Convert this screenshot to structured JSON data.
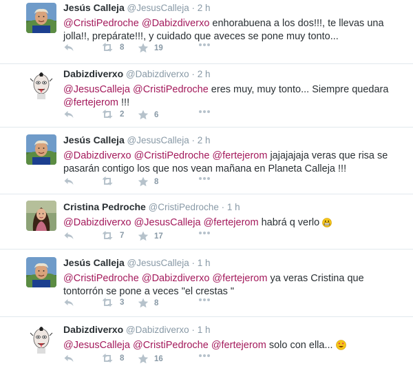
{
  "tweets": [
    {
      "name": "Jesús Calleja",
      "handle": "@JesusCalleja",
      "sep": "·",
      "time": "2 h",
      "segments": [
        {
          "t": "@CristiPedroche",
          "m": true
        },
        {
          "t": " ",
          "m": false
        },
        {
          "t": "@Dabizdiverxo",
          "m": true
        },
        {
          "t": " enhorabuena a los dos!!!, te llevas una jolla!!, prepárate!!!, y cuidado que aveces se pone muy tonto...",
          "m": false
        }
      ],
      "retweets": "8",
      "favorites": "19",
      "avatar": "calleja"
    },
    {
      "name": "Dabizdiverxo",
      "handle": "@Dabizdiverxo",
      "sep": "·",
      "time": "2 h",
      "segments": [
        {
          "t": "@JesusCalleja",
          "m": true
        },
        {
          "t": " ",
          "m": false
        },
        {
          "t": "@CristiPedroche",
          "m": true
        },
        {
          "t": " eres muy, muy tonto... Siempre quedara ",
          "m": false
        },
        {
          "t": "@fertejerom",
          "m": true
        },
        {
          "t": " !!!",
          "m": false
        }
      ],
      "retweets": "2",
      "favorites": "6",
      "avatar": "dabiz"
    },
    {
      "name": "Jesús Calleja",
      "handle": "@JesusCalleja",
      "sep": "·",
      "time": "2 h",
      "segments": [
        {
          "t": "@Dabizdiverxo",
          "m": true
        },
        {
          "t": " ",
          "m": false
        },
        {
          "t": "@CristiPedroche",
          "m": true
        },
        {
          "t": " ",
          "m": false
        },
        {
          "t": "@fertejerom",
          "m": true
        },
        {
          "t": " jajajajaja veras que risa se pasarán contigo los que nos vean mañana en Planeta Calleja !!!",
          "m": false
        }
      ],
      "retweets": "",
      "favorites": "8",
      "avatar": "calleja"
    },
    {
      "name": "Cristina Pedroche",
      "handle": "@CristiPedroche",
      "sep": "·",
      "time": "1 h",
      "segments": [
        {
          "t": "@Dabizdiverxo",
          "m": true
        },
        {
          "t": " ",
          "m": false
        },
        {
          "t": "@JesusCalleja",
          "m": true
        },
        {
          "t": " ",
          "m": false
        },
        {
          "t": "@fertejerom",
          "m": true
        },
        {
          "t": " habrá q verlo ",
          "m": false
        }
      ],
      "emoji": "grin-face",
      "retweets": "7",
      "favorites": "17",
      "avatar": "cristina"
    },
    {
      "name": "Jesús Calleja",
      "handle": "@JesusCalleja",
      "sep": "·",
      "time": "1 h",
      "segments": [
        {
          "t": "@CristiPedroche",
          "m": true
        },
        {
          "t": " ",
          "m": false
        },
        {
          "t": "@Dabizdiverxo",
          "m": true
        },
        {
          "t": " ",
          "m": false
        },
        {
          "t": "@fertejerom",
          "m": true
        },
        {
          "t": " ya veras Cristina que tontorrón se pone a veces \"el crestas \"",
          "m": false
        }
      ],
      "retweets": "3",
      "favorites": "8",
      "avatar": "calleja"
    },
    {
      "name": "Dabizdiverxo",
      "handle": "@Dabizdiverxo",
      "sep": "·",
      "time": "1 h",
      "segments": [
        {
          "t": "@JesusCalleja",
          "m": true
        },
        {
          "t": " ",
          "m": false
        },
        {
          "t": "@CristiPedroche",
          "m": true
        },
        {
          "t": " ",
          "m": false
        },
        {
          "t": "@fertejerom",
          "m": true
        },
        {
          "t": " solo con ella... ",
          "m": false
        }
      ],
      "emoji": "heart-eyes-face",
      "retweets": "8",
      "favorites": "16",
      "avatar": "dabiz"
    }
  ],
  "colors": {
    "mention": "#a3195b",
    "muted": "#8899a6",
    "divider": "#e1e8ed"
  },
  "icons": [
    "reply-icon",
    "retweet-icon",
    "favorite-star-icon",
    "more-dots-icon"
  ]
}
